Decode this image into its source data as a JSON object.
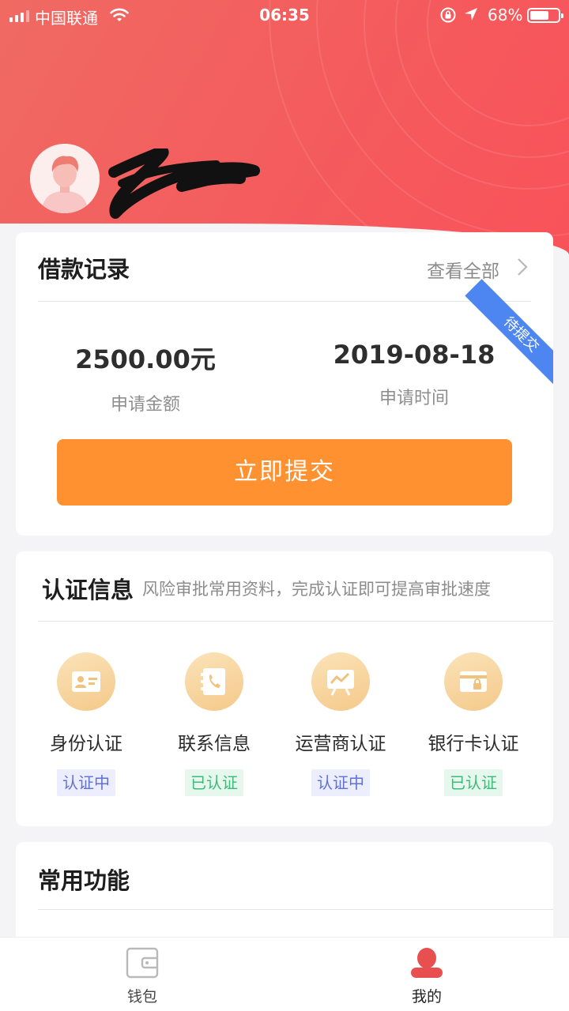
{
  "status_bar": {
    "carrier": "中国联通",
    "time": "06:35",
    "battery_percent": "68%",
    "battery_level": 0.68,
    "icons": [
      "signal-icon",
      "wifi-icon",
      "orientation-lock-icon",
      "location-arrow-icon",
      "battery-icon"
    ]
  },
  "profile": {
    "avatar_icon": "user-avatar-icon"
  },
  "loan_record": {
    "title": "借款记录",
    "view_all": "查看全部",
    "ribbon": "待提交",
    "amount_value": "2500.00元",
    "amount_label": "申请金额",
    "date_value": "2019-08-18",
    "date_label": "申请时间",
    "submit_button": "立即提交"
  },
  "auth_info": {
    "title": "认证信息",
    "subtitle": "风险审批常用资料，完成认证即可提高审批速度",
    "items": [
      {
        "name": "身份认证",
        "status": "认证中",
        "icon": "id-card-icon"
      },
      {
        "name": "联系信息",
        "status": "已认证",
        "icon": "contact-book-icon"
      },
      {
        "name": "运营商认证",
        "status": "认证中",
        "icon": "carrier-chart-icon"
      },
      {
        "name": "银行卡认证",
        "status": "已认证",
        "icon": "bank-card-lock-icon"
      }
    ]
  },
  "common_functions": {
    "title": "常用功能"
  },
  "tabbar": {
    "tabs": [
      {
        "label": "钱包",
        "icon": "wallet-icon",
        "active": false
      },
      {
        "label": "我的",
        "icon": "profile-icon",
        "active": true
      }
    ]
  },
  "colors": {
    "header_red": "#f45b5d",
    "submit_orange": "#ff9130",
    "ribbon_blue": "#4d86f0",
    "pending_text": "#6070d8",
    "done_text": "#3cbb78",
    "active_tab": "#e84f4f"
  }
}
